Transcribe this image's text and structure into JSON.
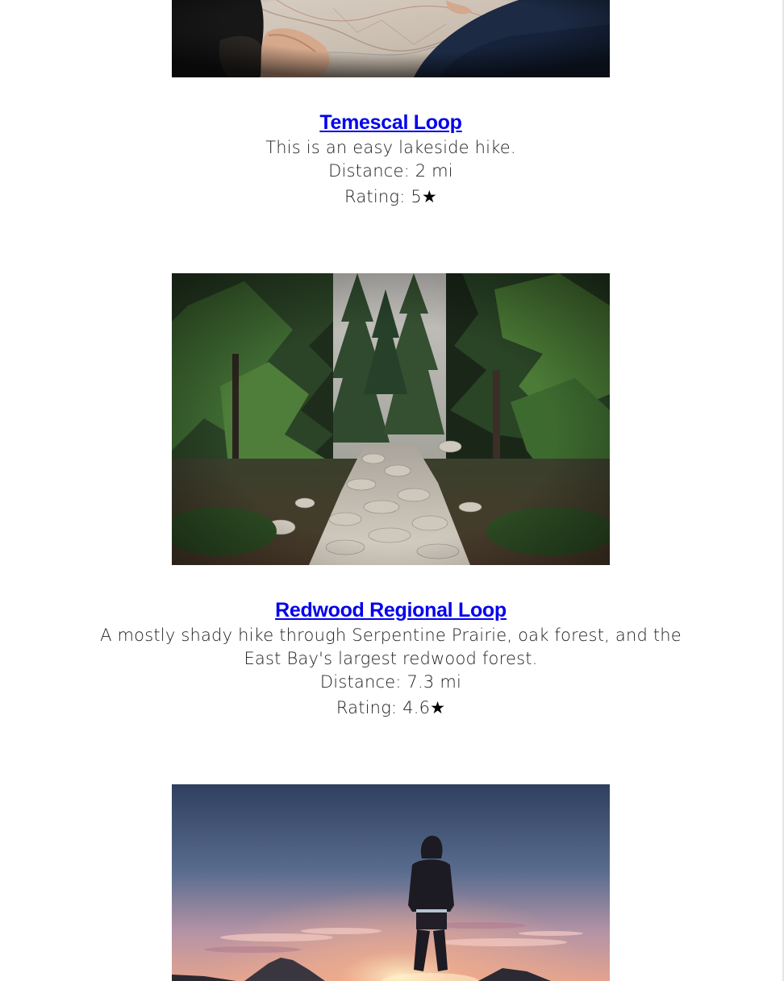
{
  "hikes": [
    {
      "image": "map-reading-photo",
      "title": "Temescal Loop",
      "description": "This is an easy lakeside hike.",
      "distance": "Distance: 2 mi",
      "rating": "Rating: 5",
      "rating_icon": "★"
    },
    {
      "image": "forest-trail-photo",
      "title": "Redwood Regional Loop",
      "description": "A mostly shady hike through Serpentine Prairie, oak forest, and the East Bay's largest redwood forest.",
      "distance": "Distance: 7.3 mi",
      "rating": "Rating: 4.6",
      "rating_icon": "★"
    },
    {
      "image": "hiker-sunset-photo"
    }
  ]
}
